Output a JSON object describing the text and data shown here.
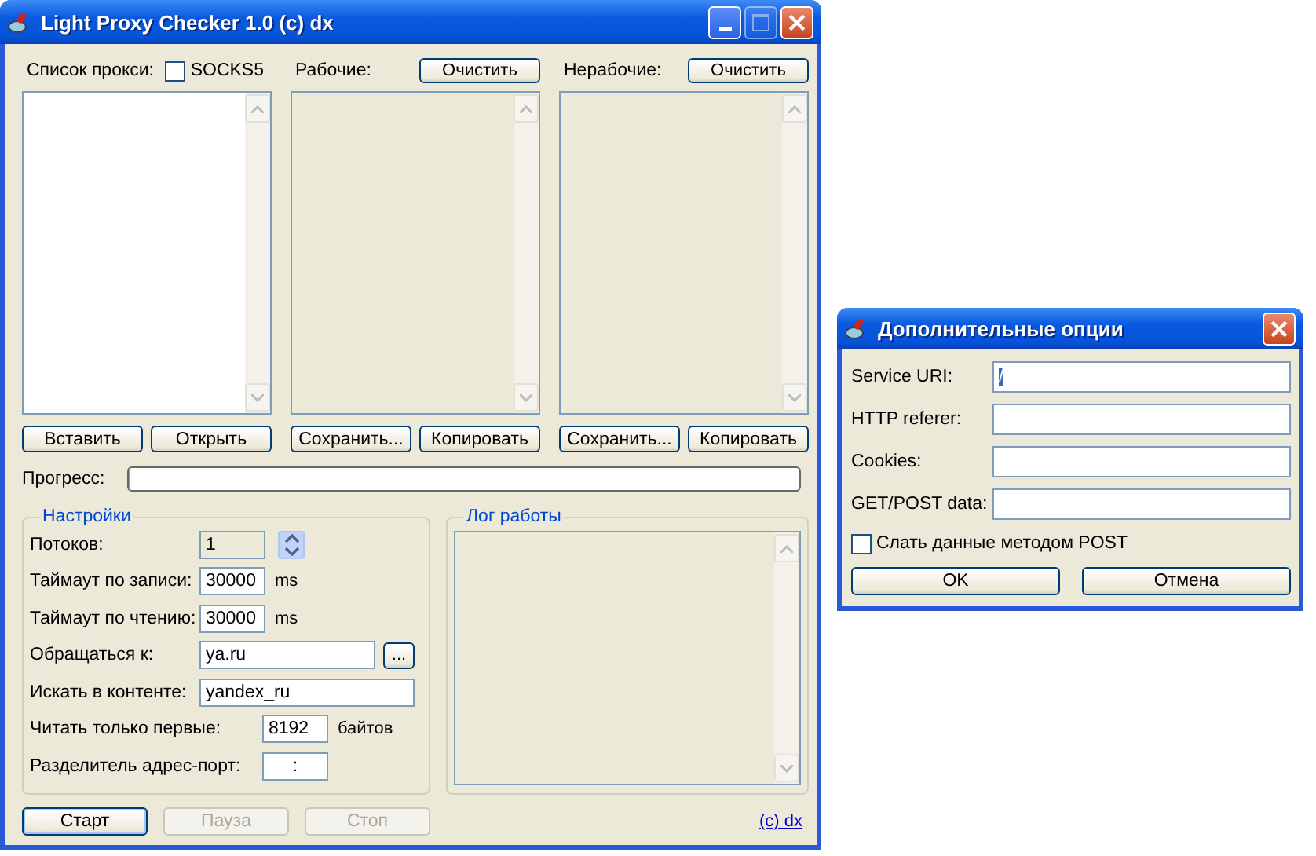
{
  "main_window": {
    "title": "Light Proxy Checker 1.0 (c) dx",
    "columns": [
      {
        "label": "Список прокси:",
        "kind": "checkbox",
        "checkbox": {
          "label": "SOCKS5",
          "checked": false
        },
        "disabled": false,
        "buttons": [
          "Вставить",
          "Открыть"
        ]
      },
      {
        "label": "Рабочие:",
        "kind": "button",
        "button": "Очистить",
        "disabled": true,
        "buttons": [
          "Сохранить...",
          "Копировать"
        ]
      },
      {
        "label": "Нерабочие:",
        "kind": "button",
        "button": "Очистить",
        "disabled": true,
        "buttons": [
          "Сохранить...",
          "Копировать"
        ]
      }
    ],
    "progress": {
      "label": "Прогресс:",
      "level": 0
    },
    "settings": {
      "title": "Настройки",
      "rows": [
        {
          "kind": "spin",
          "label": "Потоков:",
          "value": "1"
        },
        {
          "kind": "number",
          "label": "Таймаут по записи:",
          "value": "30000",
          "unit": "ms"
        },
        {
          "kind": "number",
          "label": "Таймаут по чтению:",
          "value": "30000",
          "unit": "ms"
        },
        {
          "kind": "address",
          "label": "Обращаться к:",
          "value": "ya.ru",
          "browse": "..."
        },
        {
          "kind": "text",
          "label": "Искать в контенте:",
          "value": "yandex_ru"
        },
        {
          "kind": "bytes",
          "label": "Читать только первые:",
          "value": "8192",
          "unit": "байтов"
        },
        {
          "kind": "bytes",
          "label": "Разделитель адрес-порт:",
          "value": ":"
        }
      ]
    },
    "log": {
      "title": "Лог работы"
    },
    "buttons": [
      {
        "label": "Старт",
        "disabled": false
      },
      {
        "label": "Пауза",
        "disabled": true
      },
      {
        "label": "Стоп",
        "disabled": true
      }
    ],
    "link": "(c) dx"
  },
  "dialog": {
    "title": "Дополнительные опции",
    "fields": [
      {
        "label": "Service URI:",
        "value": "/",
        "highlighted": true
      },
      {
        "label": "HTTP referer:"
      },
      {
        "label": "Cookies:"
      },
      {
        "label": "GET/POST data:"
      }
    ],
    "checkbox": {
      "label": "Слать данные методом POST",
      "checked": false
    },
    "buttons": [
      "OK",
      "Отмена"
    ]
  }
}
